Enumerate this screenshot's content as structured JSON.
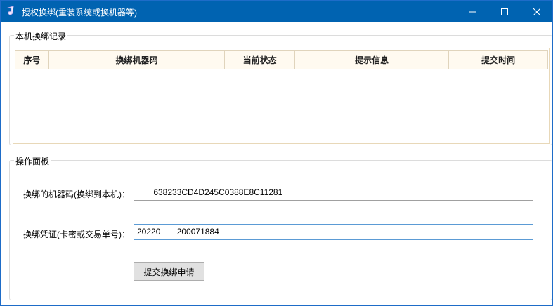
{
  "window": {
    "title": "授权换绑(重装系统或换机器等)",
    "controls": [
      "minimize",
      "maximize",
      "close"
    ]
  },
  "record_group": {
    "title": "本机换绑记录",
    "columns": [
      "序号",
      "换绑机器码",
      "当前状态",
      "提示信息",
      "提交时间"
    ],
    "rows": []
  },
  "operation_group": {
    "title": "操作面板",
    "machine_code_label": "换绑的机器码(换绑到本机)：",
    "machine_code_value": "       638233CD4D245C0388E8C11281",
    "voucher_label": "换绑凭证(卡密或交易单号)：",
    "voucher_value": "20220       200071884",
    "submit_label": "提交换绑申请"
  },
  "colors": {
    "titlebar": "#0063b1",
    "grid_header_bg": "#fffaf0"
  }
}
